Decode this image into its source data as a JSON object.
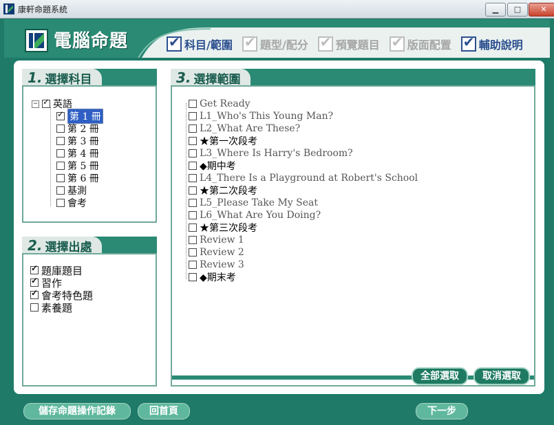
{
  "window": {
    "title": "康軒命題系統",
    "controls": {
      "minimize": "▁",
      "maximize": "□",
      "close": "✕"
    }
  },
  "header": {
    "brand": "電腦命題",
    "steps": [
      {
        "label": "科目/範圍",
        "state": "active"
      },
      {
        "label": "題型/配分",
        "state": "inactive"
      },
      {
        "label": "預覽題目",
        "state": "inactive"
      },
      {
        "label": "版面配置",
        "state": "inactive"
      },
      {
        "label": "輔助說明",
        "state": "active"
      }
    ]
  },
  "section1": {
    "num": "1.",
    "title": "選擇科目",
    "expander": "−",
    "root": {
      "label": "英語",
      "checked": true
    },
    "children": [
      {
        "label": "第 1 冊",
        "checked": true,
        "selected": true
      },
      {
        "label": "第 2 冊",
        "checked": false
      },
      {
        "label": "第 3 冊",
        "checked": false
      },
      {
        "label": "第 4 冊",
        "checked": false
      },
      {
        "label": "第 5 冊",
        "checked": false
      },
      {
        "label": "第 6 冊",
        "checked": false
      },
      {
        "label": "基測",
        "checked": false
      },
      {
        "label": "會考",
        "checked": false
      }
    ]
  },
  "section2": {
    "num": "2.",
    "title": "選擇出處",
    "items": [
      {
        "label": "題庫題目",
        "checked": true
      },
      {
        "label": "習作",
        "checked": true
      },
      {
        "label": "會考特色題",
        "checked": true
      },
      {
        "label": "素養題",
        "checked": false
      }
    ]
  },
  "section3": {
    "num": "3.",
    "title": "選擇範圍",
    "items": [
      {
        "label": "Get Ready",
        "dim": true
      },
      {
        "label": "L1_Who's This Young Man?",
        "dim": true
      },
      {
        "label": "L2_What Are These?",
        "dim": true
      },
      {
        "label": "★第一次段考",
        "dim": false
      },
      {
        "label": "L3_Where Is Harry's Bedroom?",
        "dim": true
      },
      {
        "label": "◆期中考",
        "dim": false
      },
      {
        "label": "L4_There Is a Playground at Robert's School",
        "dim": true
      },
      {
        "label": "★第二次段考",
        "dim": false
      },
      {
        "label": "L5_Please Take My Seat",
        "dim": true
      },
      {
        "label": "L6_What Are You Doing?",
        "dim": true
      },
      {
        "label": "★第三次段考",
        "dim": false
      },
      {
        "label": "Review 1",
        "dim": true
      },
      {
        "label": "Review 2",
        "dim": true
      },
      {
        "label": "Review 3",
        "dim": true
      },
      {
        "label": "◆期末考",
        "dim": false
      }
    ],
    "select_all": "全部選取",
    "deselect_all": "取消選取"
  },
  "footer": {
    "save_log": "儲存命題操作記錄",
    "home": "回首頁",
    "next": "下一步"
  }
}
